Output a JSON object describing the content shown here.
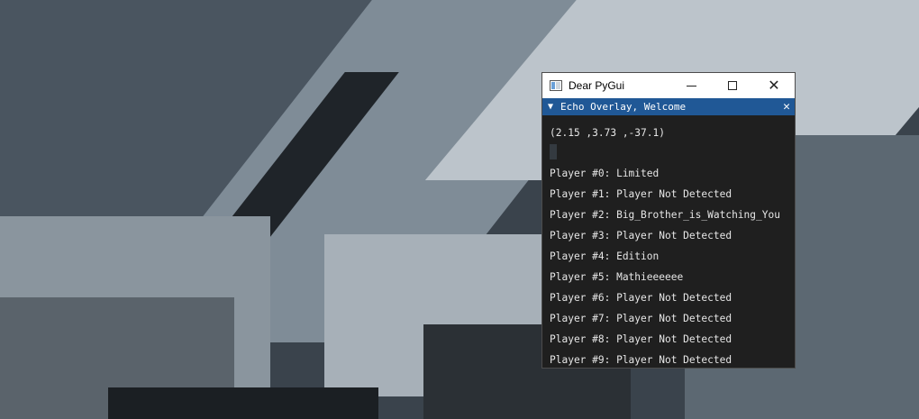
{
  "window": {
    "title": "Dear PyGui",
    "app_icon": "dear-pygui-app-icon",
    "controls": [
      "minimize-icon",
      "maximize-icon",
      "close-icon"
    ]
  },
  "imgui_window": {
    "title": "Echo Overlay, Welcome",
    "collapse_glyph": "▼",
    "close_glyph": "✕"
  },
  "coordinates": "(2.15 ,3.73 ,-37.1)",
  "players": [
    "Player #0: Limited",
    "Player #1: Player Not Detected",
    "Player #2: Big_Brother_is_Watching_You",
    "Player #3: Player Not Detected",
    "Player #4: Edition",
    "Player #5: Mathieeeeee",
    "Player #6: Player Not Detected",
    "Player #7: Player Not Detected",
    "Player #8: Player Not Detected",
    "Player #9: Player Not Detected"
  ],
  "colors": {
    "imgui_title_bg": "#205896",
    "window_bg": "#1f1f1f",
    "text": "#e6e6e6"
  }
}
